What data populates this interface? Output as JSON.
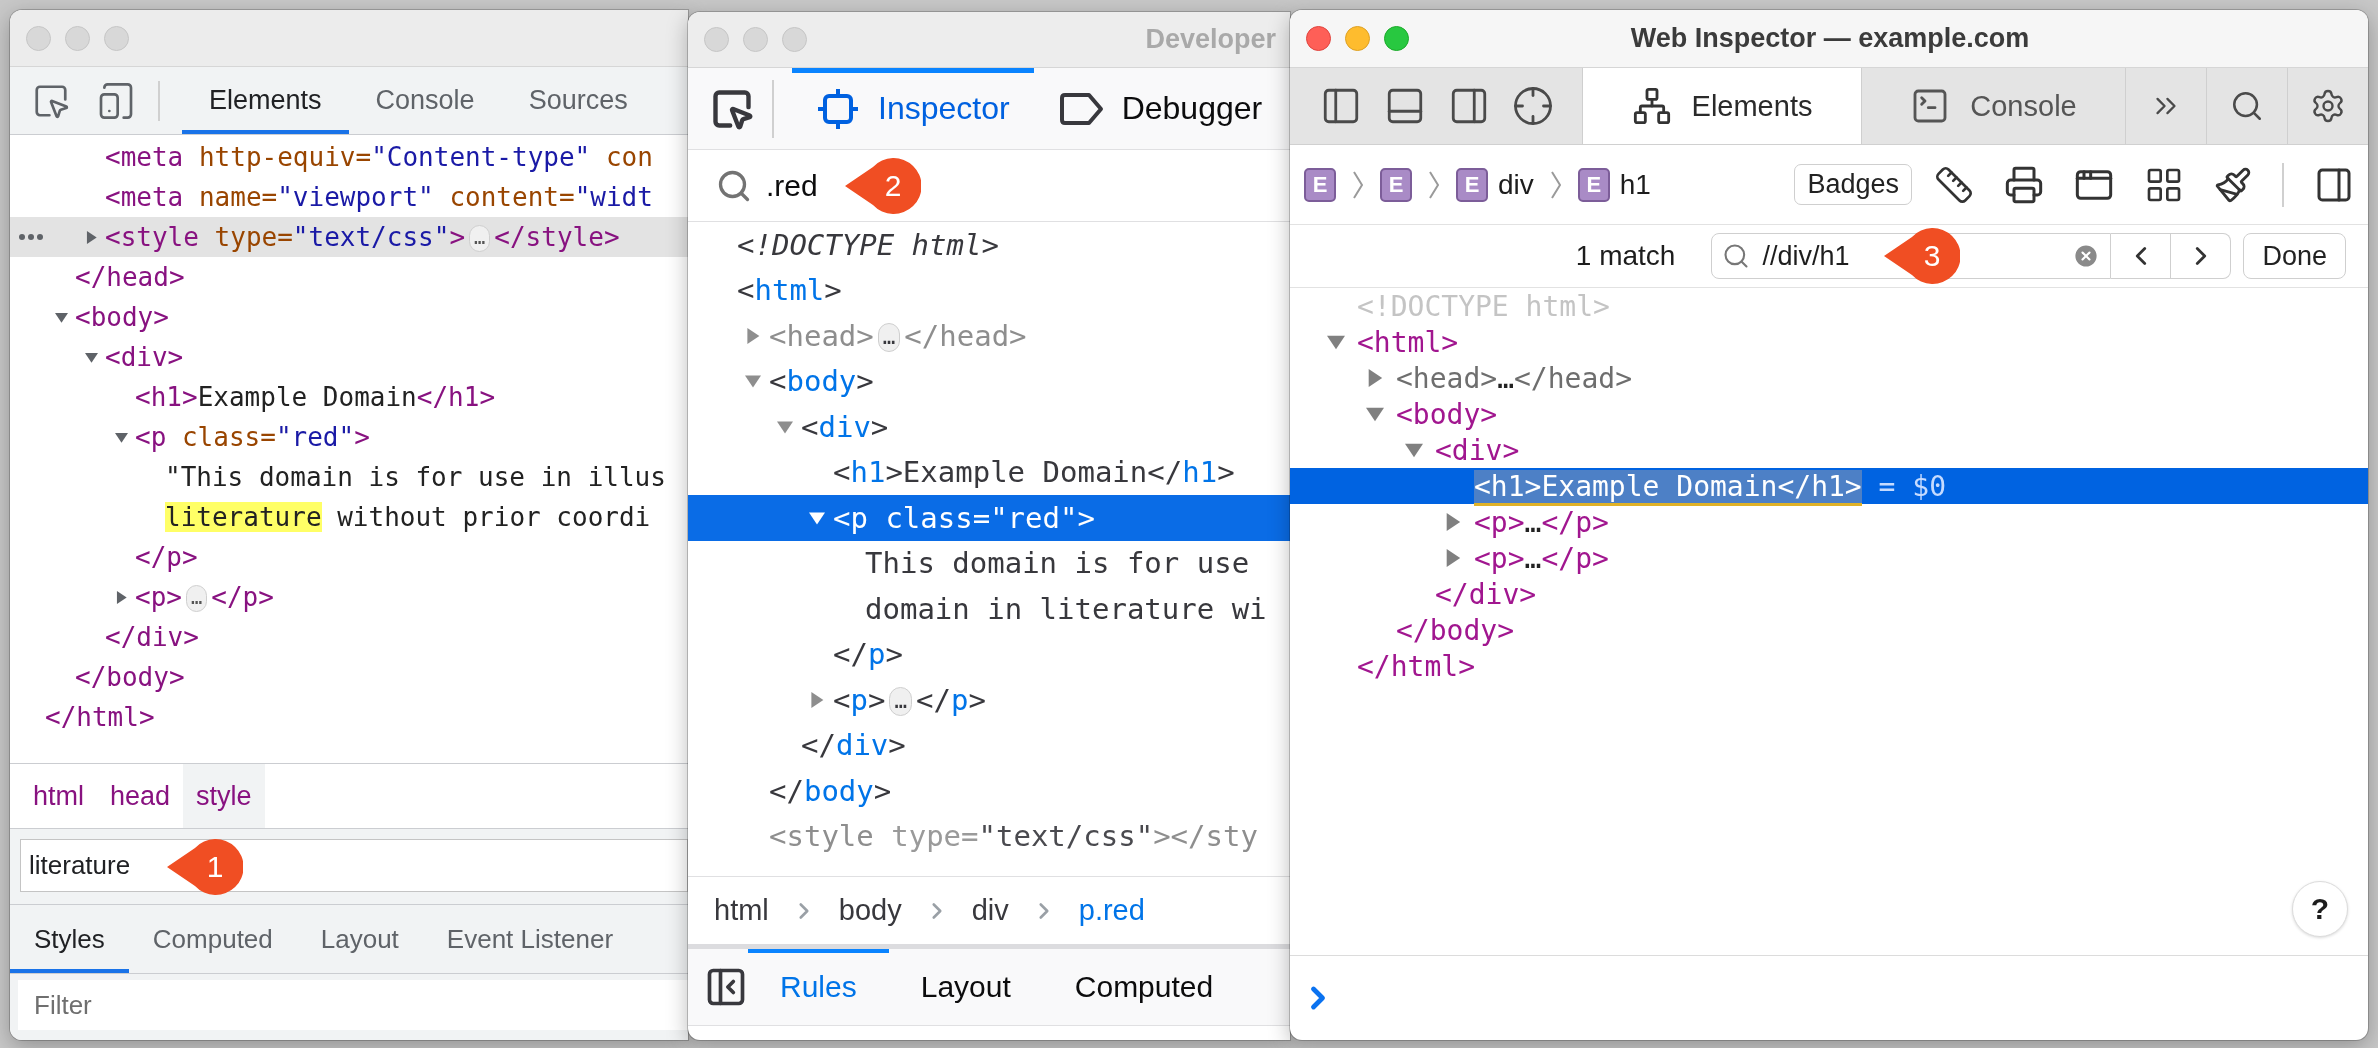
{
  "windows": [
    {
      "kind": "chrome",
      "active": false,
      "tabs": [
        {
          "label": "Elements",
          "selected": true
        },
        {
          "label": "Console",
          "selected": false
        },
        {
          "label": "Sources",
          "selected": false
        }
      ],
      "tree": [
        {
          "children": [
            {
              "children": [
                {
                  "selected": false,
                  "tokens": [
                    {
                      "kind": "tag",
                      "text": "<meta"
                    },
                    {
                      "kind": "attr",
                      "text": " http-equiv="
                    },
                    {
                      "kind": "value",
                      "text": "\"Content-type\""
                    },
                    {
                      "kind": "attr",
                      "text": " con"
                    }
                  ]
                },
                {
                  "selected": false,
                  "tokens": [
                    {
                      "kind": "tag",
                      "text": "<meta"
                    },
                    {
                      "kind": "attr",
                      "text": " name="
                    },
                    {
                      "kind": "value",
                      "text": "\"viewport\""
                    },
                    {
                      "kind": "attr",
                      "text": " content="
                    },
                    {
                      "kind": "value",
                      "text": "\"widt"
                    }
                  ]
                },
                {
                  "selected": true,
                  "expanded": false,
                  "tokens": [
                    {
                      "kind": "tag",
                      "text": "<style"
                    },
                    {
                      "kind": "attr",
                      "text": " type="
                    },
                    {
                      "kind": "value",
                      "text": "\"text/css\""
                    },
                    {
                      "kind": "tag",
                      "text": ">"
                    },
                    {
                      "kind": "ellipsis",
                      "text": "…"
                    },
                    {
                      "kind": "tag",
                      "text": "</style>"
                    }
                  ]
                }
              ]
            },
            {
              "selected": false,
              "tokens": [
                {
                  "kind": "tag",
                  "text": "</head>"
                }
              ]
            },
            {
              "selected": false,
              "expanded": true,
              "tokens": [
                {
                  "kind": "tag",
                  "text": "<body>"
                }
              ],
              "children": [
                {
                  "selected": false,
                  "expanded": true,
                  "tokens": [
                    {
                      "kind": "tag",
                      "text": "<div>"
                    }
                  ],
                  "children": [
                    {
                      "selected": false,
                      "tokens": [
                        {
                          "kind": "tag",
                          "text": "<h1>"
                        },
                        {
                          "kind": "text",
                          "text": "Example Domain"
                        },
                        {
                          "kind": "tag",
                          "text": "</h1>"
                        }
                      ]
                    },
                    {
                      "selected": false,
                      "expanded": true,
                      "tokens": [
                        {
                          "kind": "tag",
                          "text": "<p"
                        },
                        {
                          "kind": "attr",
                          "text": " class="
                        },
                        {
                          "kind": "value",
                          "text": "\"red\""
                        },
                        {
                          "kind": "tag",
                          "text": ">"
                        }
                      ],
                      "children": [
                        {
                          "selected": false,
                          "tokens": [
                            {
                              "kind": "text",
                              "text": "\"This domain is for use in illus"
                            }
                          ]
                        },
                        {
                          "selected": false,
                          "tokens": [
                            {
                              "kind": "match",
                              "text": "literature"
                            },
                            {
                              "kind": "text",
                              "text": " without prior coordi"
                            }
                          ]
                        }
                      ]
                    },
                    {
                      "selected": false,
                      "tokens": [
                        {
                          "kind": "tag",
                          "text": "</p>"
                        }
                      ]
                    },
                    {
                      "selected": false,
                      "expanded": false,
                      "tokens": [
                        {
                          "kind": "tag",
                          "text": "<p>"
                        },
                        {
                          "kind": "ellipsis",
                          "text": "…"
                        },
                        {
                          "kind": "tag",
                          "text": "</p>"
                        }
                      ]
                    }
                  ]
                },
                {
                  "selected": false,
                  "tokens": [
                    {
                      "kind": "tag",
                      "text": "</div>"
                    }
                  ]
                }
              ]
            },
            {
              "selected": false,
              "tokens": [
                {
                  "kind": "tag",
                  "text": "</body>"
                }
              ]
            }
          ]
        },
        {
          "selected": false,
          "tokens": [
            {
              "kind": "tag",
              "text": "</html>"
            }
          ]
        }
      ],
      "breadcrumbs": [
        {
          "label": "html",
          "selected": false
        },
        {
          "label": "head",
          "selected": false
        },
        {
          "label": "style",
          "selected": true
        }
      ],
      "search": {
        "value": "literature",
        "callout": "1"
      },
      "panel_tabs": [
        {
          "label": "Styles",
          "selected": true
        },
        {
          "label": "Computed",
          "selected": false
        },
        {
          "label": "Layout",
          "selected": false
        },
        {
          "label": "Event Listener",
          "selected": false
        }
      ],
      "filter": {
        "placeholder": "Filter"
      }
    },
    {
      "kind": "firefox",
      "active": false,
      "title": "Developer",
      "tabs": [
        {
          "label": "Inspector",
          "selected": true
        },
        {
          "label": "Debugger",
          "selected": false
        }
      ],
      "search": {
        "value": ".red",
        "callout": "2"
      },
      "tree": [
        {
          "selected": false,
          "tokens": [
            {
              "kind": "doctype",
              "text": "<!DOCTYPE html>"
            }
          ]
        },
        {
          "selected": false,
          "tokens": [
            {
              "kind": "punct",
              "text": "<"
            },
            {
              "kind": "tag",
              "text": "html"
            },
            {
              "kind": "punct",
              "text": ">"
            }
          ],
          "children": [
            {
              "selected": false,
              "expanded": false,
              "tokens": [
                {
                  "kind": "muted",
                  "text": "<head>"
                },
                {
                  "kind": "ellipsis",
                  "text": "…"
                },
                {
                  "kind": "muted",
                  "text": "</head>"
                }
              ]
            },
            {
              "selected": false,
              "expanded": true,
              "tokens": [
                {
                  "kind": "punct",
                  "text": "<"
                },
                {
                  "kind": "tag",
                  "text": "body"
                },
                {
                  "kind": "punct",
                  "text": ">"
                }
              ],
              "children": [
                {
                  "selected": false,
                  "expanded": true,
                  "tokens": [
                    {
                      "kind": "punct",
                      "text": "<"
                    },
                    {
                      "kind": "tag",
                      "text": "div"
                    },
                    {
                      "kind": "punct",
                      "text": ">"
                    }
                  ],
                  "children": [
                    {
                      "selected": false,
                      "tokens": [
                        {
                          "kind": "punct",
                          "text": "<"
                        },
                        {
                          "kind": "tag",
                          "text": "h1"
                        },
                        {
                          "kind": "punct",
                          "text": ">"
                        },
                        {
                          "kind": "text",
                          "text": "Example Domain"
                        },
                        {
                          "kind": "punct",
                          "text": "</"
                        },
                        {
                          "kind": "tag",
                          "text": "h1"
                        },
                        {
                          "kind": "punct",
                          "text": ">"
                        }
                      ]
                    },
                    {
                      "selected": true,
                      "expanded": true,
                      "tokens": [
                        {
                          "kind": "punct",
                          "text": "<"
                        },
                        {
                          "kind": "tag",
                          "text": "p"
                        },
                        {
                          "kind": "attr",
                          "text": " class="
                        },
                        {
                          "kind": "value",
                          "text": "\"red\""
                        },
                        {
                          "kind": "punct",
                          "text": ">"
                        }
                      ],
                      "children": [
                        {
                          "selected": false,
                          "tokens": [
                            {
                              "kind": "text",
                              "text": "This domain is for use"
                            }
                          ]
                        },
                        {
                          "selected": false,
                          "tokens": [
                            {
                              "kind": "text",
                              "text": "domain in literature wi"
                            }
                          ]
                        }
                      ]
                    },
                    {
                      "selected": false,
                      "tokens": [
                        {
                          "kind": "punct",
                          "text": "</"
                        },
                        {
                          "kind": "tag",
                          "text": "p"
                        },
                        {
                          "kind": "punct",
                          "text": ">"
                        }
                      ]
                    },
                    {
                      "selected": false,
                      "expanded": false,
                      "tokens": [
                        {
                          "kind": "punct",
                          "text": "<"
                        },
                        {
                          "kind": "tag",
                          "text": "p"
                        },
                        {
                          "kind": "punct",
                          "text": ">"
                        },
                        {
                          "kind": "ellipsis",
                          "text": "…"
                        },
                        {
                          "kind": "punct",
                          "text": "</"
                        },
                        {
                          "kind": "tag",
                          "text": "p"
                        },
                        {
                          "kind": "punct",
                          "text": ">"
                        }
                      ]
                    }
                  ]
                },
                {
                  "selected": false,
                  "tokens": [
                    {
                      "kind": "punct",
                      "text": "</"
                    },
                    {
                      "kind": "tag",
                      "text": "div"
                    },
                    {
                      "kind": "punct",
                      "text": ">"
                    }
                  ]
                }
              ]
            },
            {
              "selected": false,
              "tokens": [
                {
                  "kind": "punct",
                  "text": "</"
                },
                {
                  "kind": "tag",
                  "text": "body"
                },
                {
                  "kind": "punct",
                  "text": ">"
                }
              ]
            },
            {
              "selected": false,
              "tokens": [
                {
                  "kind": "muted",
                  "text": "<style"
                },
                {
                  "kind": "attr",
                  "text": " type="
                },
                {
                  "kind": "value",
                  "text": "\"text/css\""
                },
                {
                  "kind": "muted",
                  "text": "></sty"
                }
              ]
            }
          ]
        }
      ],
      "breadcrumbs": [
        {
          "label": "html",
          "selected": false
        },
        {
          "label": "body",
          "selected": false
        },
        {
          "label": "div",
          "selected": false
        },
        {
          "label": "p.red",
          "selected": true
        }
      ],
      "panel_tabs": [
        {
          "label": "Rules",
          "selected": true
        },
        {
          "label": "Layout",
          "selected": false
        },
        {
          "label": "Computed",
          "selected": false
        }
      ]
    },
    {
      "kind": "safari",
      "active": true,
      "title": "Web Inspector — example.com",
      "tabs": [
        {
          "label": "Elements",
          "selected": true
        },
        {
          "label": "Console",
          "selected": false
        }
      ],
      "path": [
        {
          "icon_letter": "E"
        },
        {
          "icon_letter": "E"
        },
        {
          "icon_letter": "E",
          "label": "div"
        },
        {
          "icon_letter": "E",
          "label": "h1"
        }
      ],
      "badges_button": "Badges",
      "search": {
        "match_count": "1 match",
        "value": "//div/h1",
        "callout": "3",
        "done": "Done"
      },
      "tree": [
        {
          "selected": false,
          "tokens": [
            {
              "kind": "doctype",
              "text": "<!DOCTYPE html>"
            }
          ]
        },
        {
          "selected": false,
          "expanded": true,
          "tokens": [
            {
              "kind": "tag",
              "text": "<html>"
            }
          ],
          "children": [
            {
              "selected": false,
              "expanded": false,
              "tokens": [
                {
                  "kind": "muted",
                  "text": "<head>"
                },
                {
                  "kind": "text",
                  "text": "…"
                },
                {
                  "kind": "muted",
                  "text": "</head>"
                }
              ]
            },
            {
              "selected": false,
              "expanded": true,
              "tokens": [
                {
                  "kind": "tag",
                  "text": "<body>"
                }
              ],
              "children": [
                {
                  "selected": false,
                  "expanded": true,
                  "tokens": [
                    {
                      "kind": "tag",
                      "text": "<div>"
                    }
                  ],
                  "children": [
                    {
                      "selected": true,
                      "tokens": [
                        {
                          "kind": "match",
                          "text": "<h1>Example Domain</h1>"
                        },
                        {
                          "kind": "ref",
                          "text": " = $0"
                        }
                      ]
                    },
                    {
                      "selected": false,
                      "expanded": false,
                      "tokens": [
                        {
                          "kind": "tag",
                          "text": "<p>"
                        },
                        {
                          "kind": "text",
                          "text": "…"
                        },
                        {
                          "kind": "tag",
                          "text": "</p>"
                        }
                      ]
                    },
                    {
                      "selected": false,
                      "expanded": false,
                      "tokens": [
                        {
                          "kind": "tag",
                          "text": "<p>"
                        },
                        {
                          "kind": "text",
                          "text": "…"
                        },
                        {
                          "kind": "tag",
                          "text": "</p>"
                        }
                      ]
                    }
                  ]
                },
                {
                  "selected": false,
                  "tokens": [
                    {
                      "kind": "tag",
                      "text": "</div>"
                    }
                  ]
                }
              ]
            },
            {
              "selected": false,
              "tokens": [
                {
                  "kind": "tag",
                  "text": "</body>"
                }
              ]
            }
          ]
        },
        {
          "selected": false,
          "tokens": [
            {
              "kind": "tag",
              "text": "</html>"
            }
          ]
        }
      ],
      "help_button": "?"
    }
  ]
}
